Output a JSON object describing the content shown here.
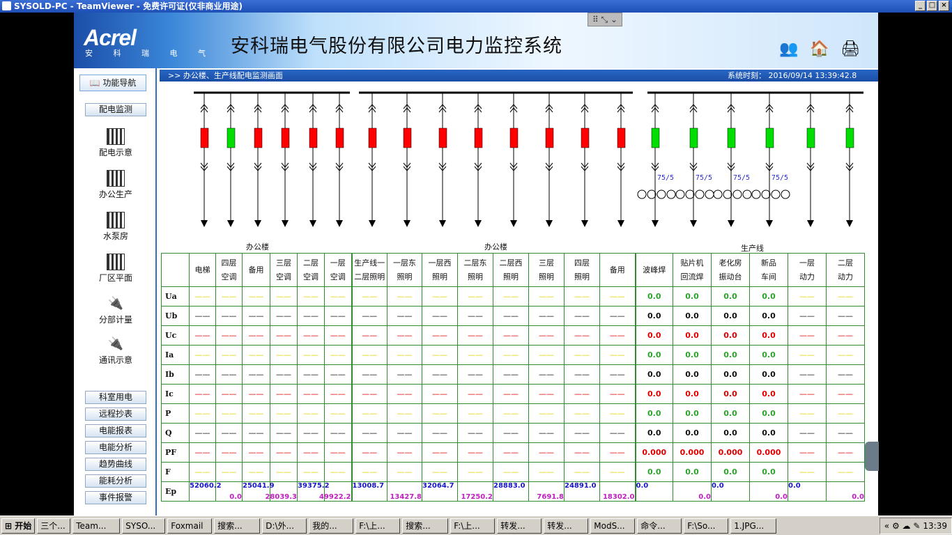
{
  "window": {
    "title": "SYSOLD-PC - TeamViewer - 免费许可证(仅非商业用途)"
  },
  "header": {
    "logo": "Acrel",
    "logo_sub": "安 科 瑞 电 气",
    "title": "安科瑞电气股份有限公司电力监控系统",
    "icons": [
      "users-icon",
      "home-icon",
      "printer-icon"
    ]
  },
  "sidebar": {
    "nav_title": "功能导航",
    "section_button": "配电监测",
    "items": [
      "配电示意",
      "办公生产",
      "水泵房",
      "厂区平面",
      "分部计量",
      "通讯示意"
    ],
    "buttons": [
      "科室用电",
      "远程抄表",
      "电能报表",
      "电能分析",
      "趋势曲线",
      "能耗分析",
      "事件报警"
    ]
  },
  "breadcrumb": ">> 办公楼、生产线配电监测画面",
  "system_time": "系统时刻：   2016/09/14    13:39:42.8",
  "diagram": {
    "ct_label": "75/5"
  },
  "sections": [
    "办公楼",
    "办公楼",
    "生产线"
  ],
  "columns": [
    [
      "电梯",
      ""
    ],
    [
      "四层",
      "空调"
    ],
    [
      "备用",
      ""
    ],
    [
      "三层",
      "空调"
    ],
    [
      "二层",
      "空调"
    ],
    [
      "一层",
      "空调"
    ],
    [
      "生产线一",
      "二层照明"
    ],
    [
      "一层东",
      "照明"
    ],
    [
      "一层西",
      "照明"
    ],
    [
      "二层东",
      "照明"
    ],
    [
      "二层西",
      "照明"
    ],
    [
      "三层",
      "照明"
    ],
    [
      "四层",
      "照明"
    ],
    [
      "备用",
      ""
    ],
    [
      "波峰焊",
      ""
    ],
    [
      "贴片机",
      "回流焊"
    ],
    [
      "老化房",
      "振动台"
    ],
    [
      "新品",
      "车间"
    ],
    [
      "一层",
      "动力"
    ],
    [
      "二层",
      "动力"
    ]
  ],
  "rows": [
    "Ua",
    "Ub",
    "Uc",
    "Ia",
    "Ib",
    "Ic",
    "P",
    "Q",
    "PF",
    "F",
    "Ep"
  ],
  "blank_value": "——",
  "meter_values": {
    "Ua": "0.0",
    "Ub": "0.0",
    "Uc": "0.0",
    "Ia": "0.0",
    "Ib": "0.0",
    "Ic": "0.0",
    "P": "0.0",
    "Q": "0.0",
    "PF": "0.000",
    "F": "0.0"
  },
  "ep": [
    {
      "top": "52060.2",
      "bottom": ""
    },
    {
      "top": "",
      "bottom": "0.0"
    },
    {
      "top": "25041.9",
      "bottom": ""
    },
    {
      "top": "",
      "bottom": "28039.3"
    },
    {
      "top": "39375.2",
      "bottom": ""
    },
    {
      "top": "",
      "bottom": "49922.2"
    },
    {
      "top": "13008.7",
      "bottom": ""
    },
    {
      "top": "",
      "bottom": "13427.8"
    },
    {
      "top": "32064.7",
      "bottom": ""
    },
    {
      "top": "",
      "bottom": "17250.2"
    },
    {
      "top": "28883.0",
      "bottom": ""
    },
    {
      "top": "",
      "bottom": "7691.8"
    },
    {
      "top": "24891.0",
      "bottom": ""
    },
    {
      "top": "",
      "bottom": "18302.0"
    },
    {
      "top": "0.0",
      "bottom": ""
    },
    {
      "top": "",
      "bottom": "0.0"
    },
    {
      "top": "0.0",
      "bottom": ""
    },
    {
      "top": "",
      "bottom": "0.0"
    },
    {
      "top": "0.0",
      "bottom": ""
    },
    {
      "top": "",
      "bottom": "0.0"
    }
  ],
  "breaker_states": [
    "on",
    "off",
    "on",
    "on",
    "on",
    "on",
    "on",
    "on",
    "on",
    "on",
    "on",
    "on",
    "on",
    "on",
    "off",
    "off",
    "off",
    "off",
    "off",
    "off"
  ],
  "taskbar": {
    "start": "开始",
    "items": [
      "三个...",
      "Team...",
      "SYSO...",
      "Foxmail",
      "搜索...",
      "D:\\外...",
      "我的...",
      "F:\\上...",
      "搜索...",
      "F:\\上...",
      "转发...",
      "转发...",
      "ModS...",
      "命令...",
      "F:\\So...",
      "1.JPG..."
    ],
    "clock": "13:39"
  },
  "colors": {
    "on": "#ff0000",
    "off": "#00dd00",
    "accent": "#1a4ea6"
  }
}
